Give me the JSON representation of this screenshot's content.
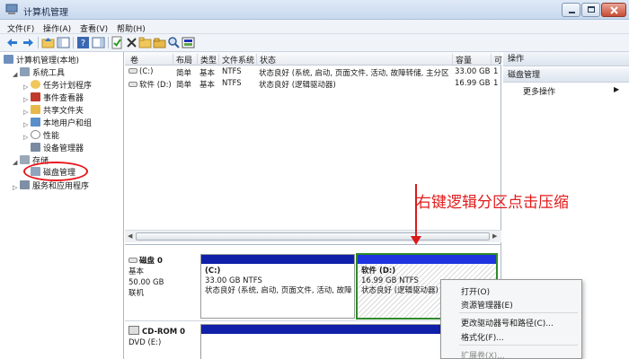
{
  "window": {
    "title": "计算机管理"
  },
  "menu": [
    "文件(F)",
    "操作(A)",
    "查看(V)",
    "帮助(H)"
  ],
  "tree": {
    "root": "计算机管理(本地)",
    "system_tools": "系统工具",
    "task_scheduler": "任务计划程序",
    "event_viewer": "事件查看器",
    "shared_folders": "共享文件夹",
    "local_users": "本地用户和组",
    "performance": "性能",
    "device_manager": "设备管理器",
    "storage": "存储",
    "disk_management": "磁盘管理",
    "services": "服务和应用程序"
  },
  "table": {
    "columns": [
      "卷",
      "布局",
      "类型",
      "文件系统",
      "状态",
      "容量",
      "可"
    ],
    "rows": [
      {
        "vol": "(C:)",
        "layout": "简单",
        "type": "基本",
        "fs": "NTFS",
        "status": "状态良好 (系统, 启动, 页面文件, 活动, 故障转储, 主分区)",
        "capacity": "33.00 GB",
        "free": "1"
      },
      {
        "vol": "软件 (D:)",
        "layout": "简单",
        "type": "基本",
        "fs": "NTFS",
        "status": "状态良好 (逻辑驱动器)",
        "capacity": "16.99 GB",
        "free": "1"
      }
    ]
  },
  "disk0": {
    "name": "磁盘 0",
    "type": "基本",
    "size": "50.00 GB",
    "state": "联机",
    "partitions": [
      {
        "label": "(C:)",
        "size": "33.00 GB NTFS",
        "status": "状态良好 (系统, 启动, 页面文件, 活动, 故障"
      },
      {
        "label": "软件  (D:)",
        "size": "16.99 GB NTFS",
        "status": "状态良好 (逻辑驱动器)"
      }
    ]
  },
  "cdrom": {
    "name": "CD-ROM 0",
    "drive": "DVD (E:)"
  },
  "actions": {
    "header": "操作",
    "section": "磁盘管理",
    "more": "更多操作"
  },
  "annotation": "右键逻辑分区点击压缩",
  "context_menu": {
    "items": [
      "打开(O)",
      "资源管理器(E)",
      "更改驱动器号和路径(C)...",
      "格式化(F)...",
      "扩展卷(X)..."
    ]
  },
  "colors": {
    "primary_partition_bar": "#1020a8",
    "logical_partition_bar": "#1f34e0",
    "selection_border": "#2f8a2b",
    "annotation": "#e21b1b"
  }
}
